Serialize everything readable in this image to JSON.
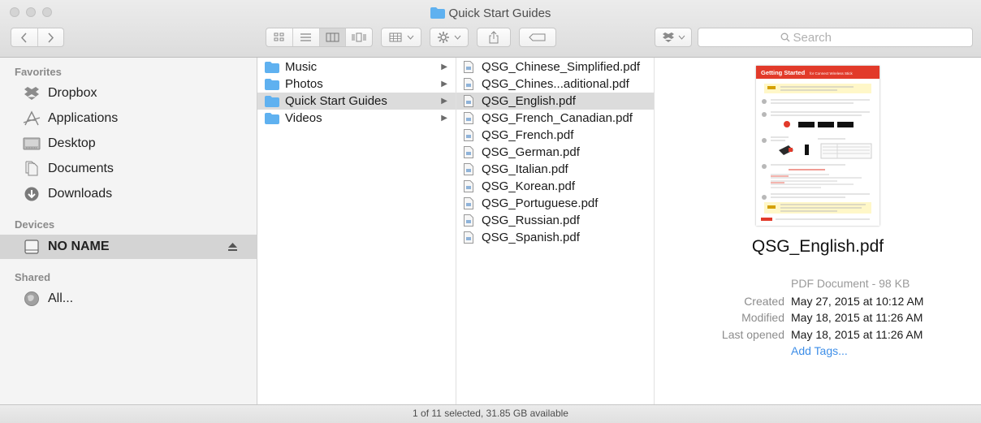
{
  "window": {
    "title": "Quick Start Guides"
  },
  "toolbar": {
    "nav": [
      "back",
      "forward"
    ],
    "search_placeholder": "Search"
  },
  "sidebar": {
    "favorites_label": "Favorites",
    "favorites": [
      {
        "label": "Dropbox",
        "icon": "dropbox-icon"
      },
      {
        "label": "Applications",
        "icon": "applications-icon"
      },
      {
        "label": "Desktop",
        "icon": "desktop-icon"
      },
      {
        "label": "Documents",
        "icon": "documents-icon"
      },
      {
        "label": "Downloads",
        "icon": "downloads-icon"
      }
    ],
    "devices_label": "Devices",
    "devices": [
      {
        "label": "NO NAME",
        "icon": "drive-icon",
        "selected": true
      }
    ],
    "shared_label": "Shared",
    "shared": [
      {
        "label": "All...",
        "icon": "network-icon"
      }
    ]
  },
  "column1": {
    "items": [
      {
        "label": "Music"
      },
      {
        "label": "Photos"
      },
      {
        "label": "Quick Start Guides",
        "selected": true
      },
      {
        "label": "Videos"
      }
    ]
  },
  "column2": {
    "items": [
      {
        "label": "QSG_Chinese_Simplified.pdf"
      },
      {
        "label": "QSG_Chines...aditional.pdf"
      },
      {
        "label": "QSG_English.pdf",
        "selected": true
      },
      {
        "label": "QSG_French_Canadian.pdf"
      },
      {
        "label": "QSG_French.pdf"
      },
      {
        "label": "QSG_German.pdf"
      },
      {
        "label": "QSG_Italian.pdf"
      },
      {
        "label": "QSG_Korean.pdf"
      },
      {
        "label": "QSG_Portuguese.pdf"
      },
      {
        "label": "QSG_Russian.pdf"
      },
      {
        "label": "QSG_Spanish.pdf"
      }
    ]
  },
  "preview": {
    "thumbnail_title": "Getting Started",
    "thumbnail_subtitle": "for Connect Wireless Stick",
    "filename": "QSG_English.pdf",
    "kind": "PDF Document - 98 KB",
    "created_label": "Created",
    "created_value": "May 27, 2015 at 10:12 AM",
    "modified_label": "Modified",
    "modified_value": "May 18, 2015 at 11:26 AM",
    "opened_label": "Last opened",
    "opened_value": "May 18, 2015 at 11:26 AM",
    "tags_label": "Add Tags..."
  },
  "statusbar": {
    "text": "1 of 11 selected, 31.85 GB available"
  },
  "colors": {
    "folder_blue": "#5fb1f0",
    "selection_gray": "#dcdcdc",
    "link_blue": "#3d8ee8",
    "thumb_red": "#e23a2a"
  }
}
